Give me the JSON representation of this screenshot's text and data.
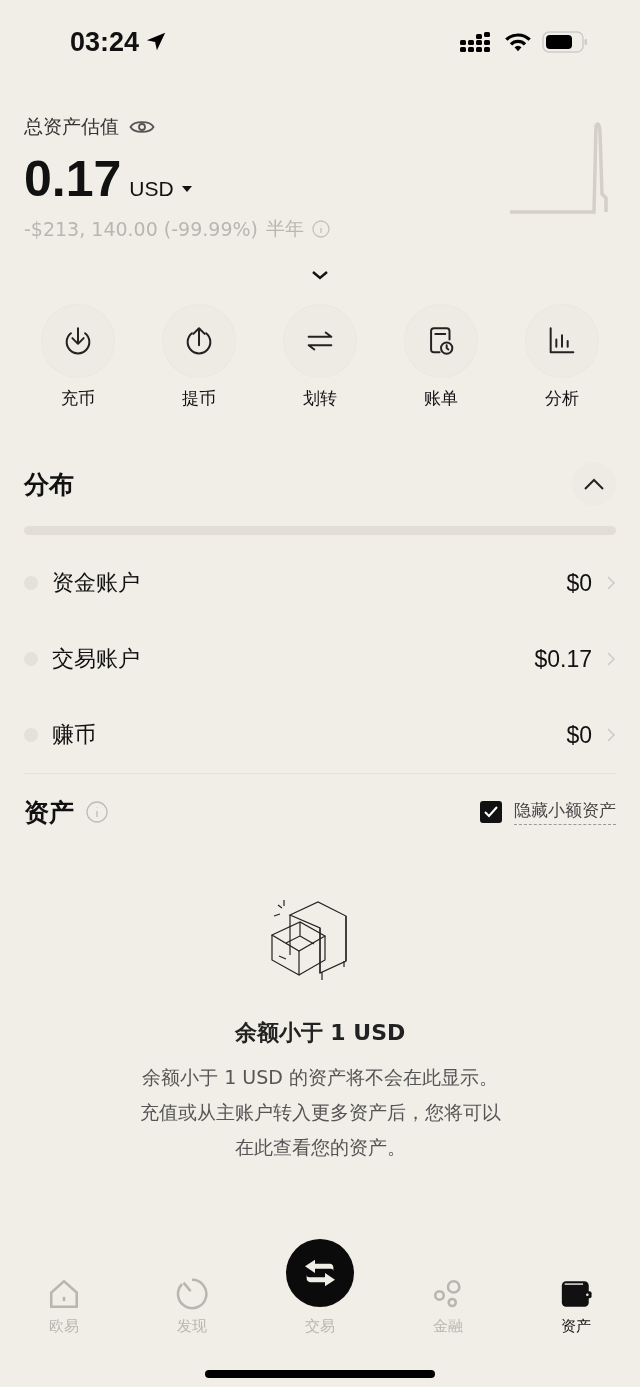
{
  "status_bar": {
    "time": "03:24"
  },
  "summary": {
    "label": "总资产估值",
    "amount": "0.17",
    "currency": "USD",
    "change": "-$213, 140.00 (-99.99%)",
    "period": "半年"
  },
  "actions": [
    {
      "kind": "deposit",
      "label": "充币"
    },
    {
      "kind": "withdraw",
      "label": "提币"
    },
    {
      "kind": "transfer",
      "label": "划转"
    },
    {
      "kind": "bill",
      "label": "账单"
    },
    {
      "kind": "analysis",
      "label": "分析"
    }
  ],
  "distribution": {
    "title": "分布",
    "expanded": true,
    "accounts": [
      {
        "name": "资金账户",
        "value": "$0"
      },
      {
        "name": "交易账户",
        "value": "$0.17"
      },
      {
        "name": "赚币",
        "value": "$0"
      }
    ]
  },
  "assets": {
    "title": "资产",
    "hide_small": {
      "label": "隐藏小额资产",
      "checked": true
    },
    "empty": {
      "title": "余额小于 1 USD",
      "text": "余额小于 1 USD 的资产将不会在此显示。充值或从主账户转入更多资产后，您将可以在此查看您的资产。"
    }
  },
  "tab_bar": [
    {
      "kind": "home",
      "label": "欧易",
      "selected": false
    },
    {
      "kind": "discover",
      "label": "发现",
      "selected": false
    },
    {
      "kind": "trade",
      "label": "交易",
      "selected": false
    },
    {
      "kind": "finance",
      "label": "金融",
      "selected": false
    },
    {
      "kind": "assets",
      "label": "资产",
      "selected": true
    }
  ]
}
